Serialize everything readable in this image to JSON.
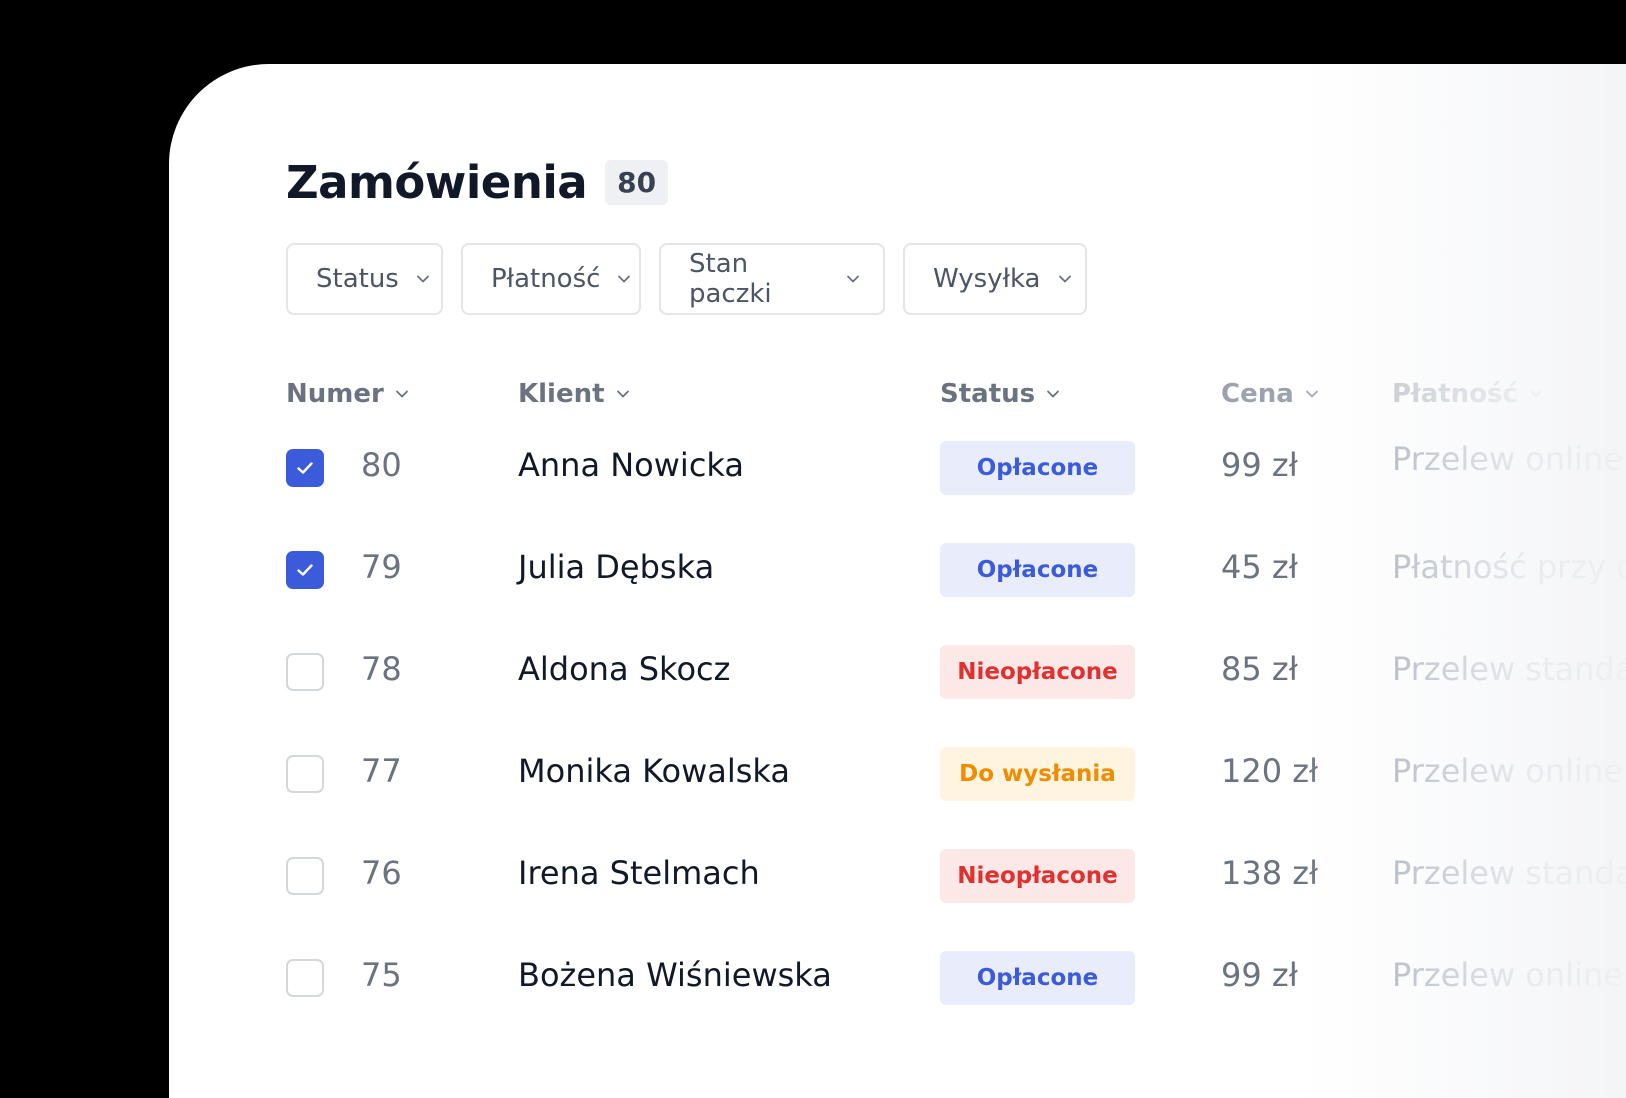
{
  "page": {
    "title": "Zamówienia",
    "count": "80"
  },
  "filters": [
    {
      "label": "Status"
    },
    {
      "label": "Płatność"
    },
    {
      "label": "Stan paczki"
    },
    {
      "label": "Wysyłka"
    }
  ],
  "table": {
    "columns": {
      "number": "Numer",
      "client": "Klient",
      "status": "Status",
      "price": "Cena",
      "payment": "Płatność"
    },
    "rows": [
      {
        "checked": true,
        "number": "80",
        "client": "Anna Nowicka",
        "status": "Opłacone",
        "status_type": "paid",
        "price": "99 zł",
        "payment": "Przelew online"
      },
      {
        "checked": true,
        "number": "79",
        "client": "Julia Dębska",
        "status": "Opłacone",
        "status_type": "paid",
        "price": "45 zł",
        "payment": "Płatność przy o"
      },
      {
        "checked": false,
        "number": "78",
        "client": "Aldona Skocz",
        "status": "Nieopłacone",
        "status_type": "unpaid",
        "price": "85 zł",
        "payment": "Przelew standa"
      },
      {
        "checked": false,
        "number": "77",
        "client": "Monika Kowalska",
        "status": "Do wysłania",
        "status_type": "to_ship",
        "price": "120 zł",
        "payment": "Przelew online"
      },
      {
        "checked": false,
        "number": "76",
        "client": "Irena Stelmach",
        "status": "Nieopłacone",
        "status_type": "unpaid",
        "price": "138 zł",
        "payment": "Przelew standa"
      },
      {
        "checked": false,
        "number": "75",
        "client": "Bożena Wiśniewska",
        "status": "Opłacone",
        "status_type": "paid",
        "price": "99 zł",
        "payment": "Przelew online"
      }
    ]
  },
  "colors": {
    "accent": "#3b5bdb",
    "paid_bg": "#e9edfb",
    "paid_fg": "#3b5bdb",
    "unpaid_bg": "#fde8e8",
    "unpaid_fg": "#e03131",
    "to_ship_bg": "#fff4e0",
    "to_ship_fg": "#f08c00"
  },
  "icons": {
    "dropdown": "chevron-down-icon",
    "check": "checkmark-icon"
  }
}
